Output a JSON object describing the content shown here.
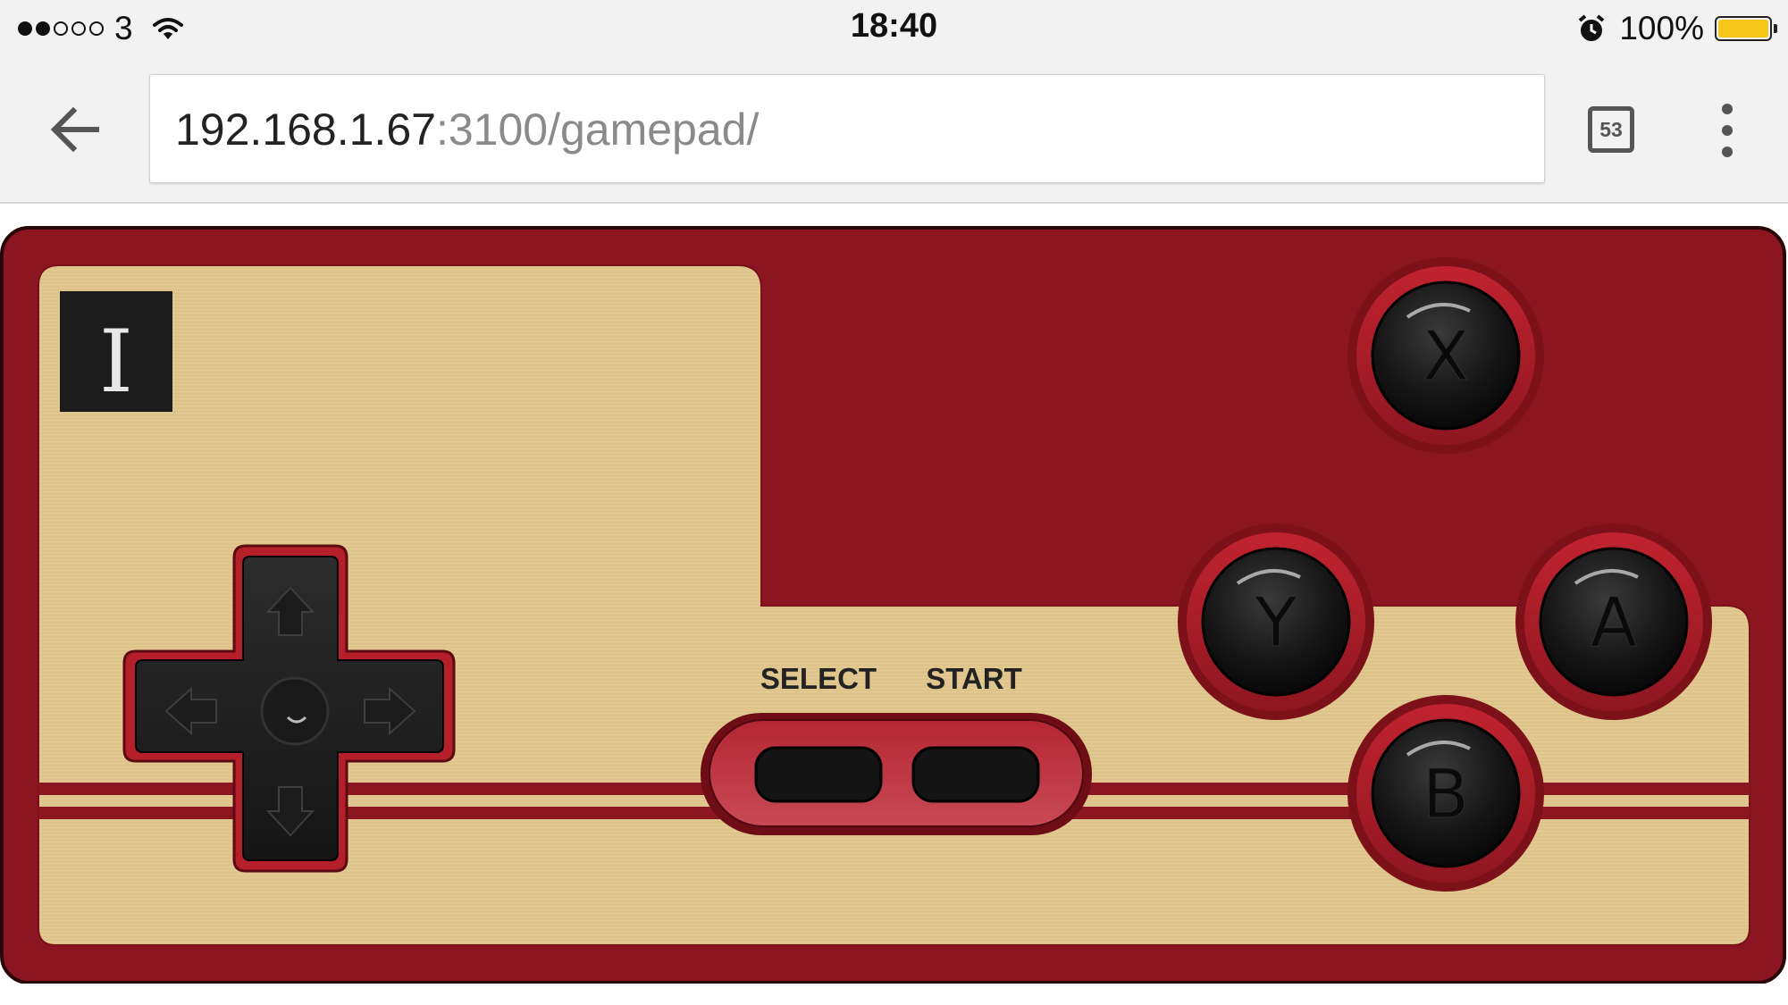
{
  "status_bar": {
    "carrier": "3",
    "signal_bars_filled": 2,
    "signal_bars_total": 5,
    "time": "18:40",
    "battery_percent": "100%",
    "battery_level": 1.0
  },
  "browser": {
    "url_host": "192.168.1.67",
    "url_path": ":3100/gamepad/",
    "tab_count": "53"
  },
  "gamepad": {
    "player_label": "I",
    "select_label": "SELECT",
    "start_label": "START",
    "buttons": {
      "x": "X",
      "y": "Y",
      "a": "A",
      "b": "B"
    }
  },
  "colors": {
    "controller_red": "#8b1520",
    "panel_gold": "#e2c98f",
    "button_black": "#111111",
    "battery_yellow": "#f5c518"
  },
  "icons": {
    "back": "arrow-left-icon",
    "menu": "more-vert-icon",
    "wifi": "wifi-icon",
    "alarm": "alarm-icon",
    "battery": "battery-icon"
  }
}
